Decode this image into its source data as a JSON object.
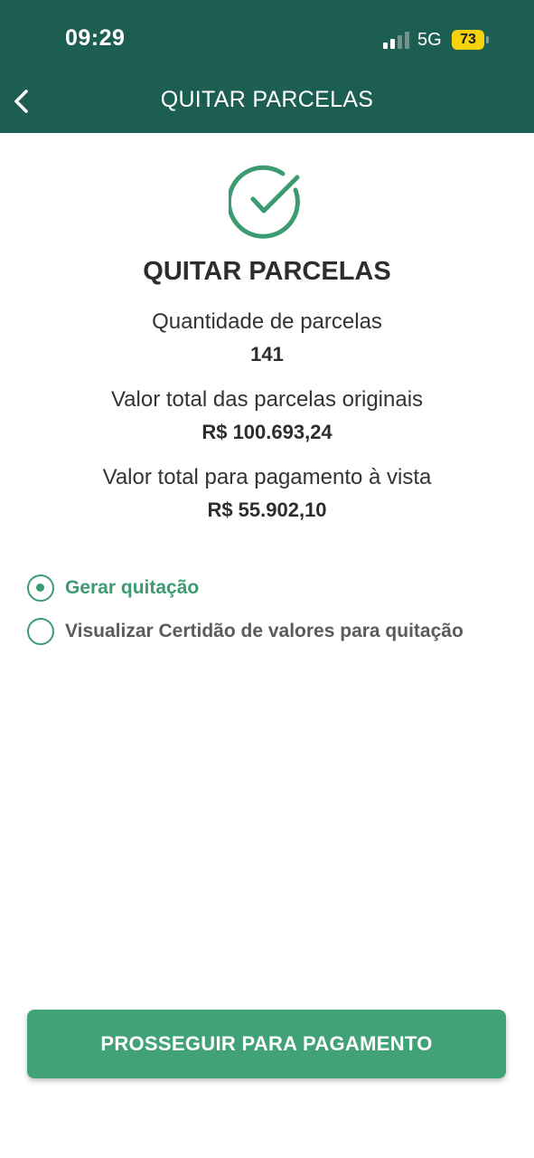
{
  "status_bar": {
    "time": "09:29",
    "network": "5G",
    "battery": "73",
    "signal_bars_active": 2,
    "signal_bars_total": 4
  },
  "nav": {
    "back_icon": "chevron-left-icon",
    "title": "QUITAR PARCELAS"
  },
  "summary": {
    "icon": "check-circle-icon",
    "title": "QUITAR PARCELAS",
    "items": [
      {
        "label": "Quantidade de parcelas",
        "value": "141"
      },
      {
        "label": "Valor total das parcelas originais",
        "value": "R$ 100.693,24"
      },
      {
        "label": "Valor total para pagamento à vista",
        "value": "R$ 55.902,10"
      }
    ]
  },
  "options": [
    {
      "label": "Gerar quitação",
      "selected": true
    },
    {
      "label": "Visualizar Certidão de valores para quitação",
      "selected": false
    }
  ],
  "cta": {
    "label": "PROSSEGUIR PARA PAGAMENTO"
  },
  "colors": {
    "header_bg": "#1c5e52",
    "accent": "#41a277",
    "battery": "#f5d20c"
  }
}
